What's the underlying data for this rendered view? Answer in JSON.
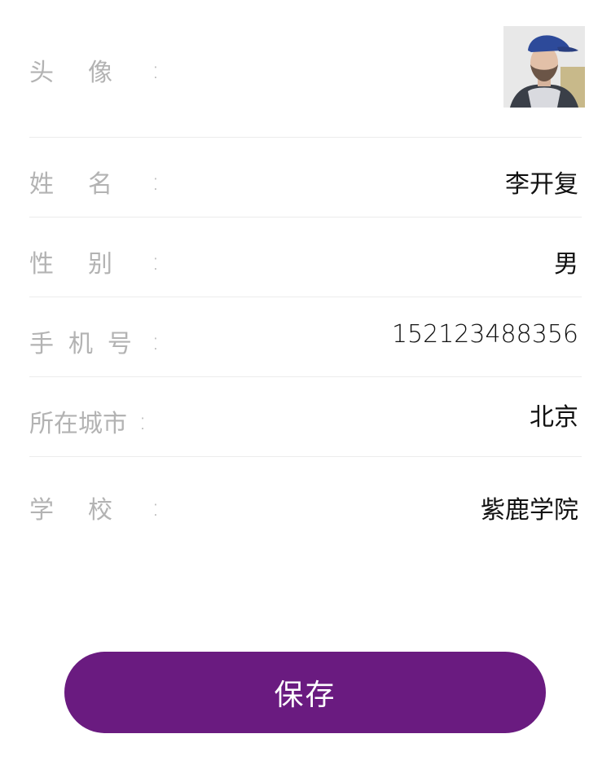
{
  "profile": {
    "avatar": {
      "label_chars": [
        "头",
        "像"
      ],
      "colon": ":"
    },
    "name": {
      "label_chars": [
        "姓",
        "名"
      ],
      "colon": ":",
      "value": "李开复"
    },
    "gender": {
      "label_chars": [
        "性",
        "别"
      ],
      "colon": ":",
      "value": "男"
    },
    "phone": {
      "label_chars": [
        "手",
        "机",
        "号"
      ],
      "colon": ":",
      "value": "152123488356"
    },
    "city": {
      "label": "所在城市",
      "colon": ":",
      "value": "北京"
    },
    "school": {
      "label_chars": [
        "学",
        "校"
      ],
      "colon": ":",
      "value": "紫鹿学院"
    }
  },
  "actions": {
    "save_label": "保存"
  },
  "colors": {
    "accent": "#6a1b80",
    "label": "#b3b3b3",
    "divider": "#ececec"
  }
}
